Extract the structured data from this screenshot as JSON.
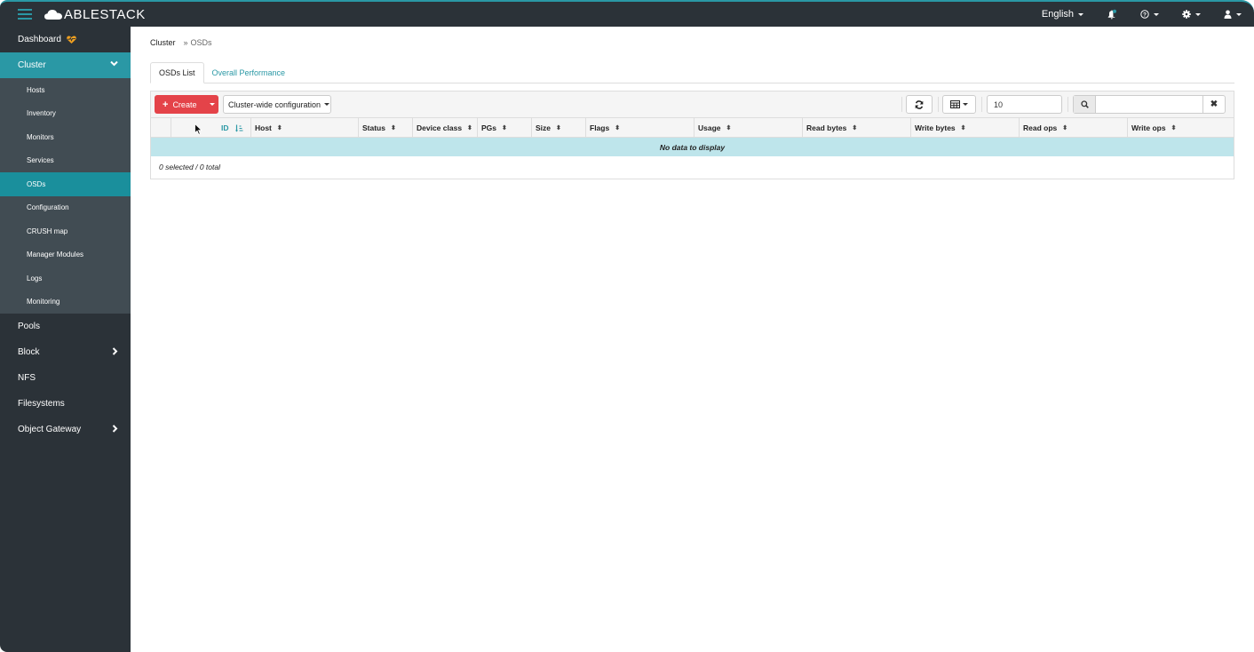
{
  "app": {
    "brand": "ABLESTACK"
  },
  "topbar": {
    "language": "English",
    "icons": [
      "notification-bell-icon",
      "help-icon",
      "settings-gear-icon",
      "user-icon"
    ]
  },
  "sidebar": {
    "dashboard": "Dashboard",
    "cluster": {
      "label": "Cluster",
      "items": [
        "Hosts",
        "Inventory",
        "Monitors",
        "Services",
        "OSDs",
        "Configuration",
        "CRUSH map",
        "Manager Modules",
        "Logs",
        "Monitoring"
      ],
      "active": "OSDs"
    },
    "items": [
      "Pools",
      "Block",
      "NFS",
      "Filesystems",
      "Object Gateway"
    ]
  },
  "breadcrumb": {
    "parent": "Cluster",
    "separator": "»",
    "current": "OSDs"
  },
  "tabs": [
    {
      "label": "OSDs List",
      "active": true
    },
    {
      "label": "Overall Performance",
      "active": false
    }
  ],
  "toolbar": {
    "create_label": "Create",
    "config_label": "Cluster-wide configuration",
    "page_size": "10",
    "search_placeholder": ""
  },
  "table": {
    "columns": [
      "ID",
      "Host",
      "Status",
      "Device class",
      "PGs",
      "Size",
      "Flags",
      "Usage",
      "Read bytes",
      "Write bytes",
      "Read ops",
      "Write ops"
    ],
    "sorted_column": "ID",
    "rows": [],
    "empty_message": "No data to display",
    "footer": "0 selected / 0 total"
  },
  "colors": {
    "accent": "#2a98a5",
    "danger": "#e44349",
    "nav_bg": "#2b3238",
    "subnav_bg": "#414c53",
    "empty_row": "#bee5eb"
  }
}
